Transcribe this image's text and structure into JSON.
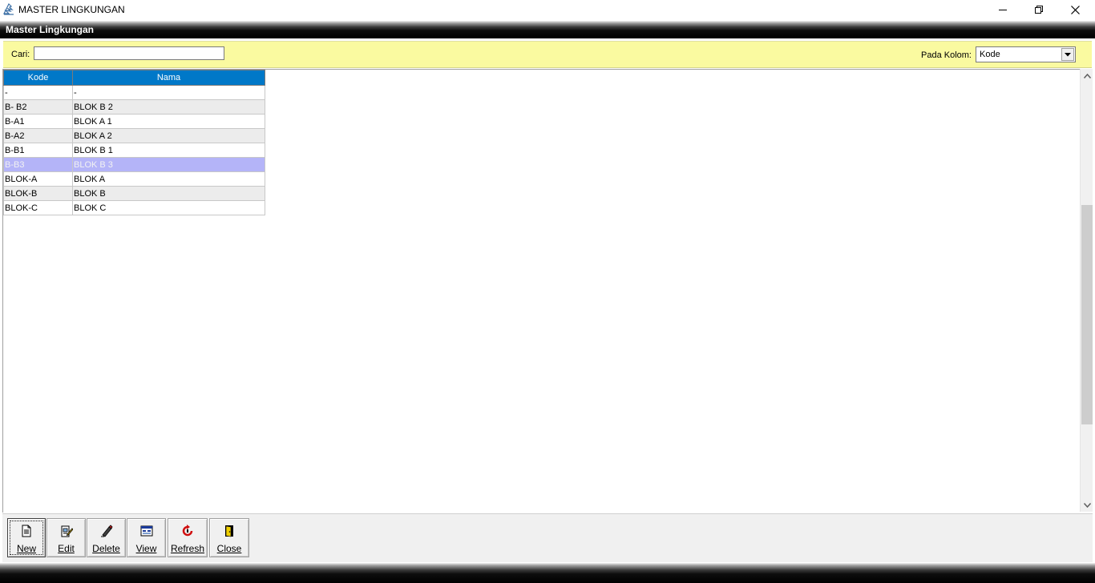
{
  "window": {
    "title": "MASTER LINGKUNGAN",
    "controls": [
      "minimize",
      "restore",
      "close"
    ]
  },
  "header": {
    "title": "Master Lingkungan"
  },
  "search": {
    "label": "Cari:",
    "value": "",
    "column_label": "Pada Kolom:",
    "column_selected": "Kode"
  },
  "grid": {
    "columns": [
      "Kode",
      "Nama"
    ],
    "rows": [
      {
        "kode": "-",
        "nama": "-"
      },
      {
        "kode": "B- B2",
        "nama": "BLOK B 2"
      },
      {
        "kode": "B-A1",
        "nama": "BLOK A 1"
      },
      {
        "kode": "B-A2",
        "nama": "BLOK A 2"
      },
      {
        "kode": "B-B1",
        "nama": "BLOK B 1"
      },
      {
        "kode": "B-B3",
        "nama": "BLOK B 3"
      },
      {
        "kode": "BLOK-A",
        "nama": "BLOK A"
      },
      {
        "kode": "BLOK-B",
        "nama": "BLOK B"
      },
      {
        "kode": "BLOK-C",
        "nama": "BLOK C"
      }
    ],
    "selected_row": 5
  },
  "toolbar": {
    "new": "New",
    "edit": "Edit",
    "delete": "Delete",
    "view": "View",
    "refresh": "Refresh",
    "close": "Close"
  },
  "colors": {
    "grid_header": "#0078c8",
    "search_panel": "#fafaa0",
    "selected_row": "#b4b4f8",
    "alt_row": "#ececec"
  }
}
